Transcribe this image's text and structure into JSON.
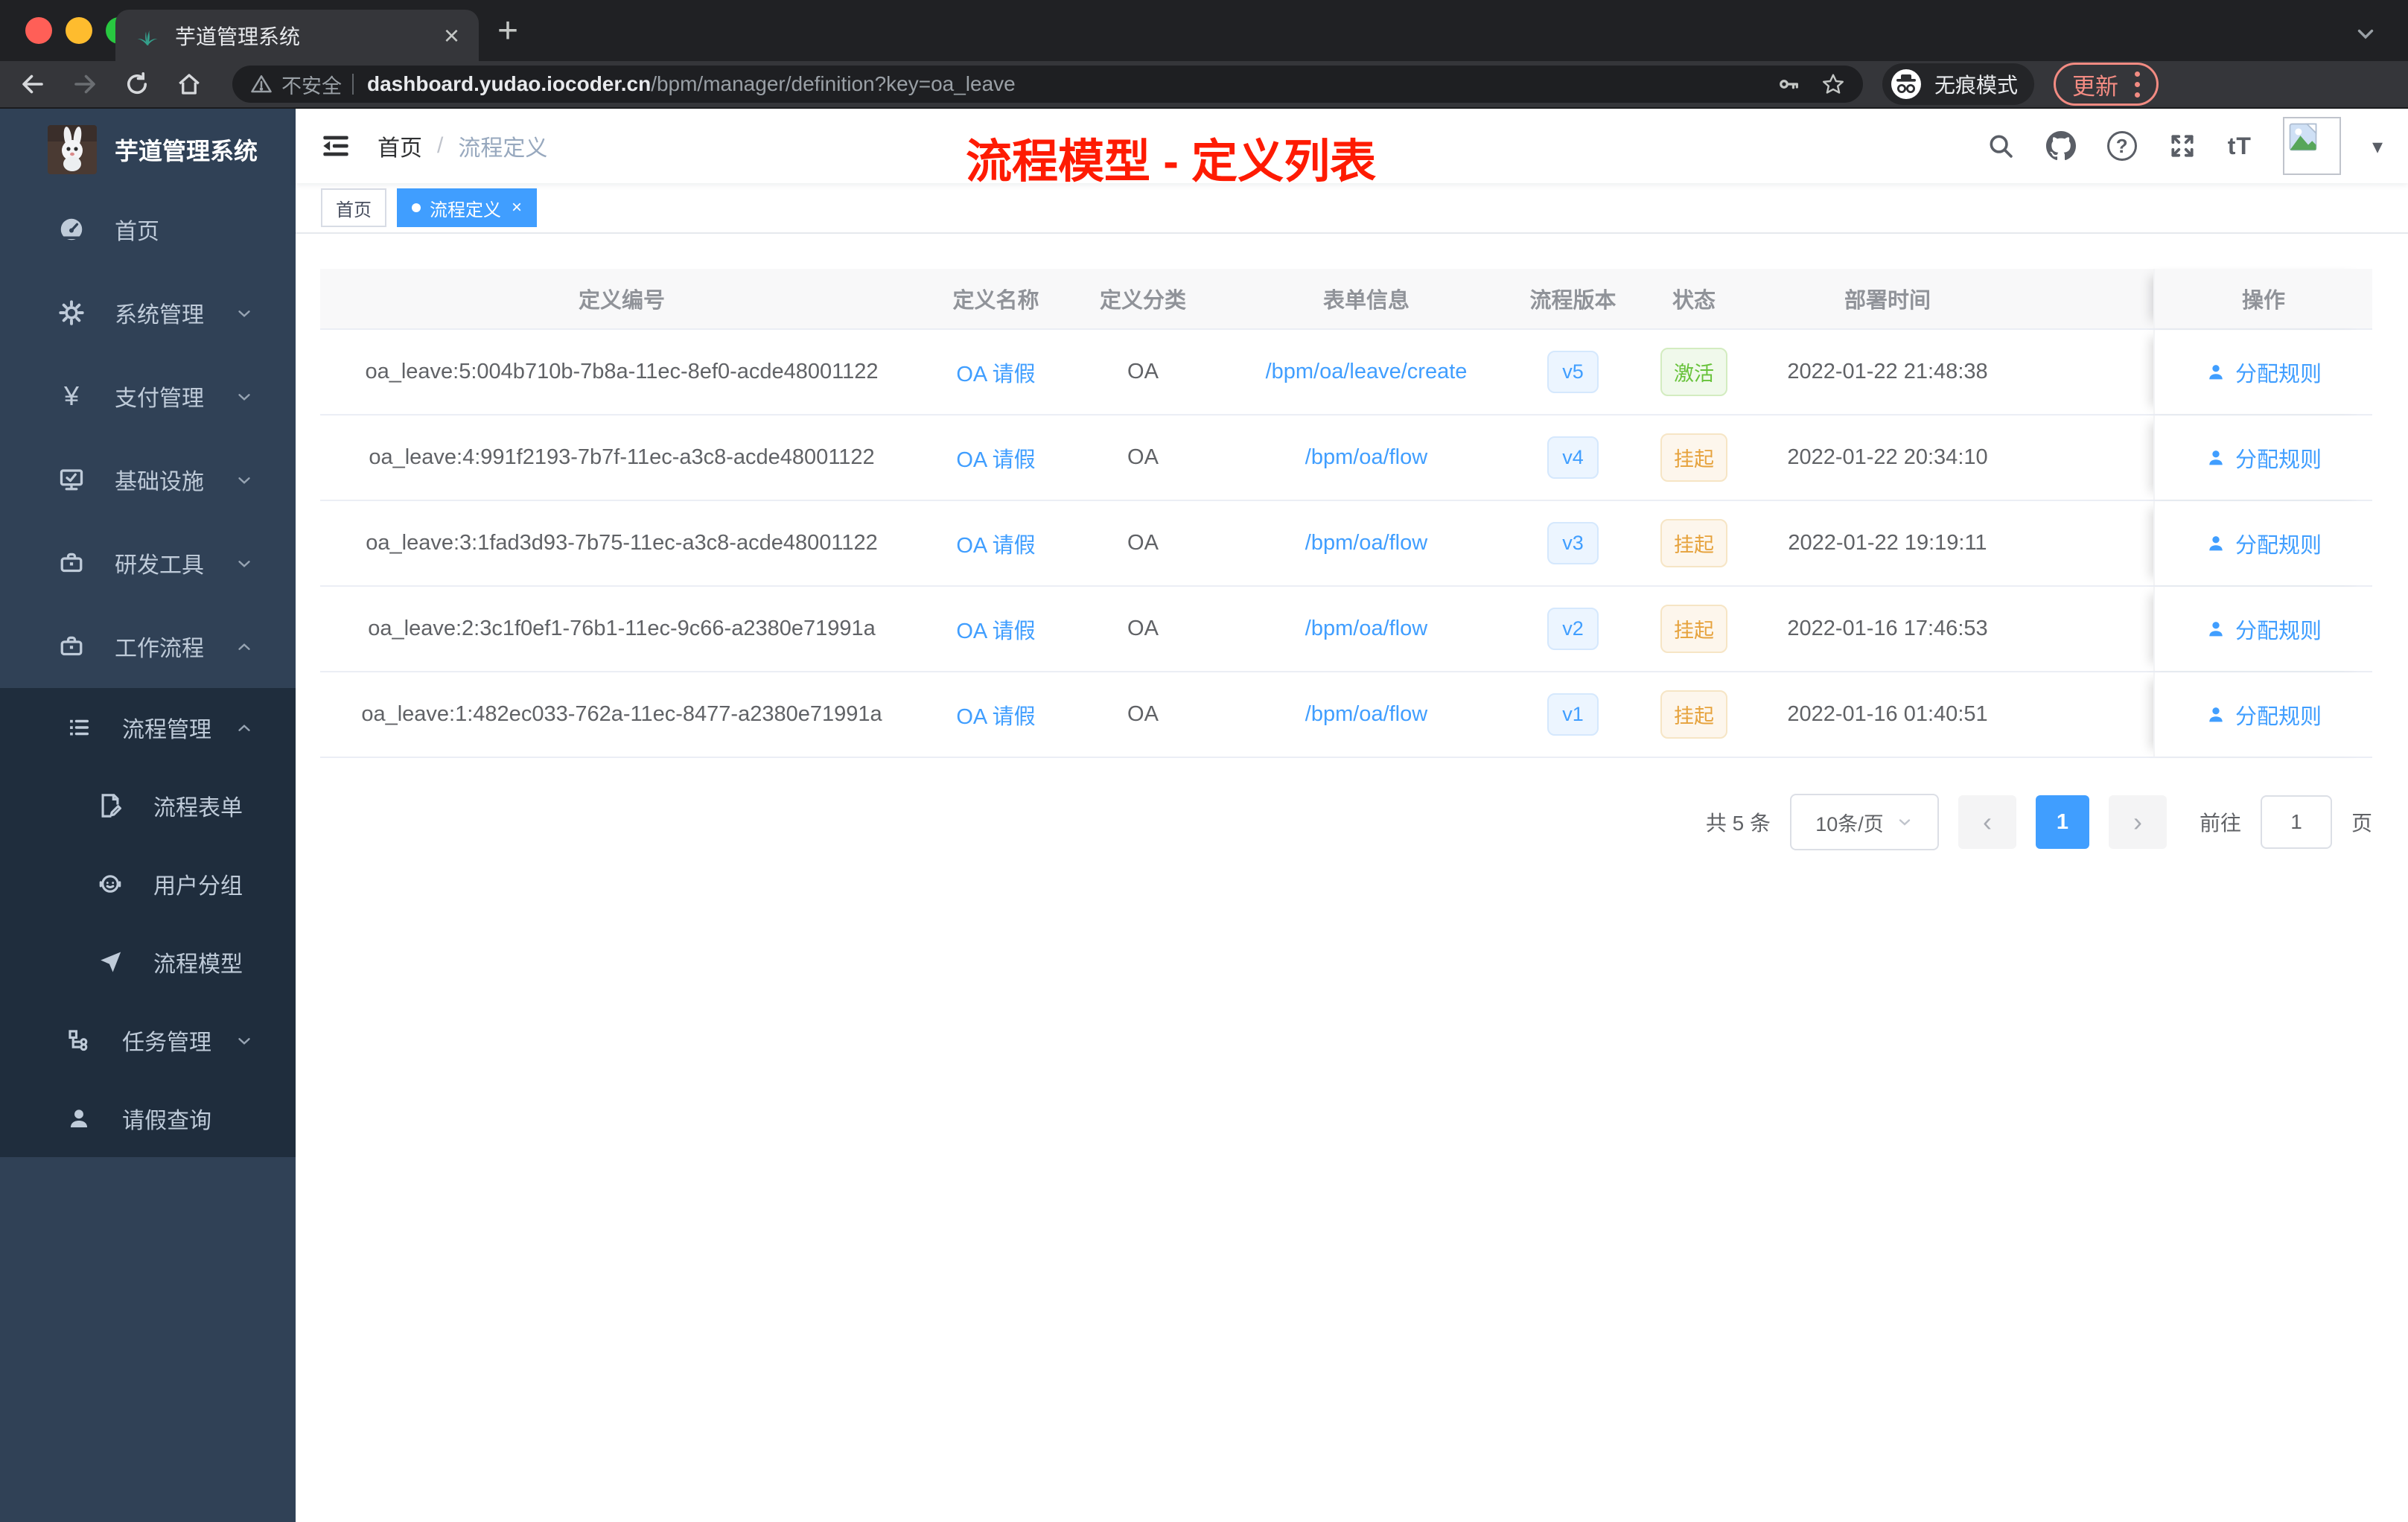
{
  "browser": {
    "tab_title": "芋道管理系统",
    "security_label": "不安全",
    "url_host": "dashboard.yudao.iocoder.cn",
    "url_path": "/bpm/manager/definition?key=oa_leave",
    "incognito_label": "无痕模式",
    "update_label": "更新"
  },
  "icons": {
    "close": "×",
    "plus": "+",
    "caret_down": "▾",
    "question": "?",
    "font_size": "tT",
    "yen": "¥",
    "prev": "‹",
    "next": "›"
  },
  "sidebar": {
    "logo_title": "芋道管理系统",
    "menu": [
      {
        "label": "首页"
      },
      {
        "label": "系统管理"
      },
      {
        "label": "支付管理"
      },
      {
        "label": "基础设施"
      },
      {
        "label": "研发工具"
      },
      {
        "label": "工作流程"
      }
    ],
    "submenu": [
      {
        "label": "流程管理"
      },
      {
        "label": "流程表单"
      },
      {
        "label": "用户分组"
      },
      {
        "label": "流程模型"
      },
      {
        "label": "任务管理"
      },
      {
        "label": "请假查询"
      }
    ]
  },
  "navbar": {
    "breadcrumb_home": "首页",
    "breadcrumb_sep": "/",
    "breadcrumb_current": "流程定义",
    "annotation": "流程模型 - 定义列表"
  },
  "tags": [
    {
      "label": "首页"
    },
    {
      "label": "流程定义"
    }
  ],
  "table": {
    "columns": [
      "定义编号",
      "定义名称",
      "定义分类",
      "表单信息",
      "流程版本",
      "状态",
      "部署时间",
      "操作"
    ],
    "action_label": "分配规则",
    "rows": [
      {
        "id": "oa_leave:5:004b710b-7b8a-11ec-8ef0-acde48001122",
        "name": "OA 请假",
        "category": "OA",
        "form": "/bpm/oa/leave/create",
        "version": "v5",
        "status": "激活",
        "time": "2022-01-22 21:48:38"
      },
      {
        "id": "oa_leave:4:991f2193-7b7f-11ec-a3c8-acde48001122",
        "name": "OA 请假",
        "category": "OA",
        "form": "/bpm/oa/flow",
        "version": "v4",
        "status": "挂起",
        "time": "2022-01-22 20:34:10"
      },
      {
        "id": "oa_leave:3:1fad3d93-7b75-11ec-a3c8-acde48001122",
        "name": "OA 请假",
        "category": "OA",
        "form": "/bpm/oa/flow",
        "version": "v3",
        "status": "挂起",
        "time": "2022-01-22 19:19:11"
      },
      {
        "id": "oa_leave:2:3c1f0ef1-76b1-11ec-9c66-a2380e71991a",
        "name": "OA 请假",
        "category": "OA",
        "form": "/bpm/oa/flow",
        "version": "v2",
        "status": "挂起",
        "time": "2022-01-16 17:46:53"
      },
      {
        "id": "oa_leave:1:482ec033-762a-11ec-8477-a2380e71991a",
        "name": "OA 请假",
        "category": "OA",
        "form": "/bpm/oa/flow",
        "version": "v1",
        "status": "挂起",
        "time": "2022-01-16 01:40:51"
      }
    ]
  },
  "pagination": {
    "total": "共 5 条",
    "page_size": "10条/页",
    "current_page": "1",
    "goto_label": "前往",
    "goto_value": "1",
    "page_unit": "页"
  },
  "colors": {
    "accent_blue": "#409eff",
    "sidebar_bg": "#304156",
    "submenu_bg": "#1f2d3d",
    "success_green": "#67c23a",
    "warning_orange": "#e6a23c",
    "annotation_red": "#fe1b02",
    "chrome_dark": "#202124",
    "chrome_toolbar": "#35363a",
    "update_red": "#f28b82"
  }
}
